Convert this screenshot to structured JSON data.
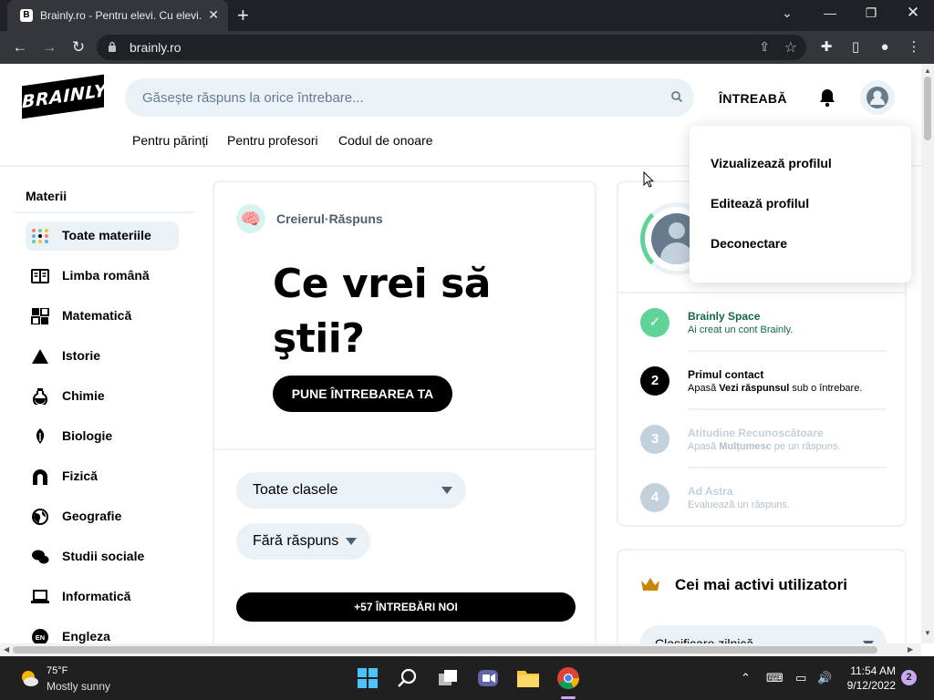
{
  "browser": {
    "tab_title": "Brainly.ro - Pentru elevi. Cu elevi.",
    "favicon_letter": "B",
    "url": "brainly.ro"
  },
  "header": {
    "logo_text": "BRAINLY",
    "search_placeholder": "Găsește răspuns la orice întrebare...",
    "ask_label": "ÎNTREABĂ",
    "subnav": [
      "Pentru părinți",
      "Pentru profesori",
      "Codul de onoare"
    ]
  },
  "sidebar": {
    "heading": "Materii",
    "items": [
      {
        "label": "Toate materiile",
        "icon": "all-subjects-icon",
        "active": true
      },
      {
        "label": "Limba română",
        "icon": "book-icon"
      },
      {
        "label": "Matematică",
        "icon": "calculator-icon"
      },
      {
        "label": "Istorie",
        "icon": "pyramid-icon"
      },
      {
        "label": "Chimie",
        "icon": "flask-icon"
      },
      {
        "label": "Biologie",
        "icon": "leaf-icon"
      },
      {
        "label": "Fizică",
        "icon": "magnet-icon"
      },
      {
        "label": "Geografie",
        "icon": "globe-icon"
      },
      {
        "label": "Studii sociale",
        "icon": "chat-icon"
      },
      {
        "label": "Informatică",
        "icon": "laptop-icon"
      },
      {
        "label": "Engleza",
        "icon": "language-icon"
      }
    ]
  },
  "main": {
    "author": "Creierul·Răspuns",
    "hero": "Ce vrei să ştii?",
    "cta": "PUNE ÎNTREBAREA TA",
    "grade_filter": "Toate clasele",
    "answer_filter": "Fără răspuns",
    "new_questions": "+57 ÎNTREBĂRI NOI"
  },
  "progress": {
    "steps": [
      {
        "number": "✓",
        "title": "Brainly Space",
        "pre": "Ai creat un cont Brainly.",
        "bold": "",
        "post": "",
        "state": "done"
      },
      {
        "number": "2",
        "title": "Primul contact",
        "pre": "Apasă ",
        "bold": "Vezi răspunsul",
        "post": " sub o întrebare.",
        "state": "current"
      },
      {
        "number": "3",
        "title": "Atitudine Recunoscătoare",
        "pre": "Apasă ",
        "bold": "Mulțumesc",
        "post": " pe un răspuns.",
        "state": "locked"
      },
      {
        "number": "4",
        "title": "Ad Astra",
        "pre": "Evaluează un răspuns.",
        "bold": "",
        "post": "",
        "state": "locked"
      }
    ]
  },
  "leaders": {
    "title": "Cei mai activi utilizatori",
    "period": "Clasificare zilnică"
  },
  "profile_menu": {
    "items": [
      "Vizualizează profilul",
      "Editează profilul",
      "Deconectare"
    ]
  },
  "taskbar": {
    "temperature": "75°F",
    "condition": "Mostly sunny",
    "time": "11:54 AM",
    "date": "9/12/2022",
    "notifications": "2"
  },
  "colors": {
    "accent_green": "#60d399",
    "green_text": "#136a42",
    "light_blue_bg": "#ebf2f7",
    "gray_text": "#687b8c"
  }
}
